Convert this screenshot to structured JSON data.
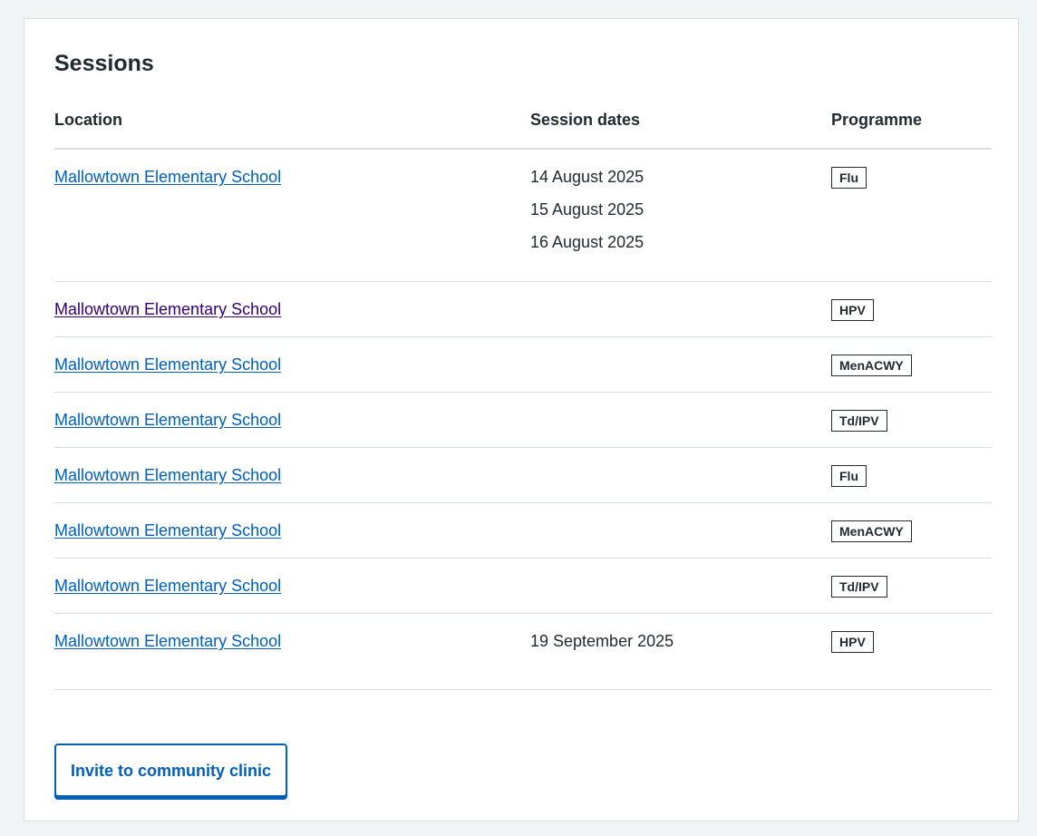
{
  "card": {
    "title": "Sessions"
  },
  "table": {
    "headers": {
      "location": "Location",
      "dates": "Session dates",
      "programme": "Programme"
    },
    "rows": [
      {
        "location": "Mallowtown Elementary School",
        "dates": [
          "14 August 2025",
          "15 August 2025",
          "16 August 2025"
        ],
        "programme": "Flu",
        "visited": false
      },
      {
        "location": "Mallowtown Elementary School",
        "dates": [],
        "programme": "HPV",
        "visited": true
      },
      {
        "location": "Mallowtown Elementary School",
        "dates": [],
        "programme": "MenACWY",
        "visited": false
      },
      {
        "location": "Mallowtown Elementary School",
        "dates": [],
        "programme": "Td/IPV",
        "visited": false
      },
      {
        "location": "Mallowtown Elementary School",
        "dates": [],
        "programme": "Flu",
        "visited": false
      },
      {
        "location": "Mallowtown Elementary School",
        "dates": [],
        "programme": "MenACWY",
        "visited": false
      },
      {
        "location": "Mallowtown Elementary School",
        "dates": [],
        "programme": "Td/IPV",
        "visited": false
      },
      {
        "location": "Mallowtown Elementary School",
        "dates": [
          "19 September 2025"
        ],
        "programme": "HPV",
        "visited": false
      }
    ]
  },
  "actions": {
    "invite_label": "Invite to community clinic"
  },
  "colors": {
    "link": "#005eb8",
    "link_visited": "#330072",
    "text": "#212b32",
    "border": "#d8dde0",
    "page_background": "#f0f4f5"
  }
}
